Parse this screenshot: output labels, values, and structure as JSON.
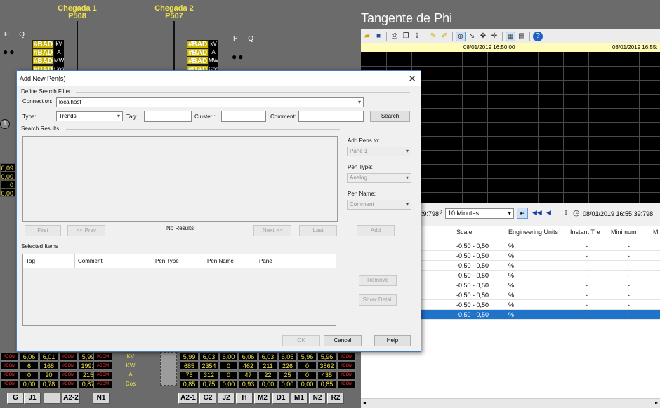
{
  "scada": {
    "incoming": [
      {
        "title": "Chegada 1",
        "code": "P508"
      },
      {
        "title": "Chegada 2",
        "code": "P507"
      }
    ],
    "pq_label": "P Q",
    "bad_label": "#BAD",
    "units": [
      "kV",
      "A",
      "MW",
      "Cos"
    ],
    "left_values": [
      "6,09",
      "0,00",
      "0",
      "0,00"
    ],
    "left_marker": "1",
    "mid_labels": [
      "KV",
      "KW",
      "A",
      "Cos"
    ],
    "left_cells": [
      [
        "#COM",
        "6,06",
        "6,01",
        "#COM",
        "5,99"
      ],
      [
        "#COM",
        "6",
        "168",
        "#COM",
        "1991"
      ],
      [
        "#COM",
        "0",
        "20",
        "#COM",
        "215"
      ],
      [
        "#COM",
        "0,00",
        "0,78",
        "#COM",
        "0,87"
      ]
    ],
    "left_com_cell": "#COM",
    "right_cells": [
      [
        "5,99",
        "6,03",
        "6,00",
        "6,06",
        "6,03",
        "6,05",
        "5,96",
        "5,96",
        "#COM"
      ],
      [
        "685",
        "2354",
        "0",
        "462",
        "211",
        "226",
        "0",
        "3862",
        "#COM"
      ],
      [
        "75",
        "312",
        "0",
        "47",
        "22",
        "25",
        "0",
        "435",
        "#COM"
      ],
      [
        "0,85",
        "0,75",
        "0,00",
        "0,93",
        "0,00",
        "0,00",
        "0,00",
        "0,85",
        "#COM"
      ]
    ],
    "feeders": [
      "G",
      "J1",
      "",
      "A2-2",
      "N1",
      "A2-1",
      "C2",
      "J2",
      "H",
      "M2",
      "D1",
      "M1",
      "N2",
      "R2"
    ]
  },
  "trend": {
    "title": "Tangente de Phi",
    "time_labels": [
      "08/01/2019 16:50:00",
      "08/01/2019 16:55:"
    ],
    "ctrl": {
      "left_time": ":9:798",
      "span": "10 Minutes",
      "right_time": "08/01/2019 16:55:39:798"
    },
    "grid_headers": [
      "Scale",
      "Engineering Units",
      "Instant Tre",
      "Minimum",
      "M"
    ],
    "rows": [
      {
        "scale": "-0,50 - 0,50",
        "eu": "%",
        "inst": "-",
        "min": "-"
      },
      {
        "scale": "-0,50 - 0,50",
        "eu": "%",
        "inst": "-",
        "min": "-"
      },
      {
        "scale": "-0,50 - 0,50",
        "eu": "%",
        "inst": "-",
        "min": "-"
      },
      {
        "scale": "-0,50 - 0,50",
        "eu": "%",
        "inst": "-",
        "min": "-"
      },
      {
        "scale": "-0,50 - 0,50",
        "eu": "%",
        "inst": "-",
        "min": "-"
      },
      {
        "scale": "-0,50 - 0,50",
        "eu": "%",
        "inst": "-",
        "min": "-"
      },
      {
        "scale": "-0,50 - 0,50",
        "eu": "%",
        "inst": "-",
        "min": "-"
      },
      {
        "scale": "-0,50 - 0,50",
        "eu": "%",
        "inst": "-",
        "min": "-"
      }
    ],
    "selected_row": 7
  },
  "dialog": {
    "title": "Add New Pen(s)",
    "close": "✕",
    "define_filter": "Define Search Filter",
    "connection_label": "Connection:",
    "connection_value": "localhost",
    "type_label": "Type:",
    "type_value": "Trends",
    "tag_label": "Tag:",
    "tag_value": "",
    "cluster_label": "Cluster :",
    "cluster_value": "",
    "comment_label": "Comment:",
    "comment_value": "",
    "search_button": "Search",
    "search_results": "Search Results",
    "add_pens_to_label": "Add Pens to:",
    "add_pens_to_value": "Pane 1",
    "pen_type_label": "Pen Type:",
    "pen_type_value": "Analog",
    "pen_name_label": "Pen Name:",
    "pen_name_value": "Comment",
    "first": "First",
    "prev": "<< Prev",
    "no_results": "No Results",
    "next": "Next >>",
    "last": "Last",
    "add": "Add",
    "selected_items": "Selected Items",
    "columns": [
      "Tag",
      "Comment",
      "Pen Type",
      "Pen Name",
      "Pane"
    ],
    "remove": "Remove",
    "show_detail": "Show Detail",
    "ok": "OK",
    "cancel": "Cancel",
    "help": "Help"
  }
}
